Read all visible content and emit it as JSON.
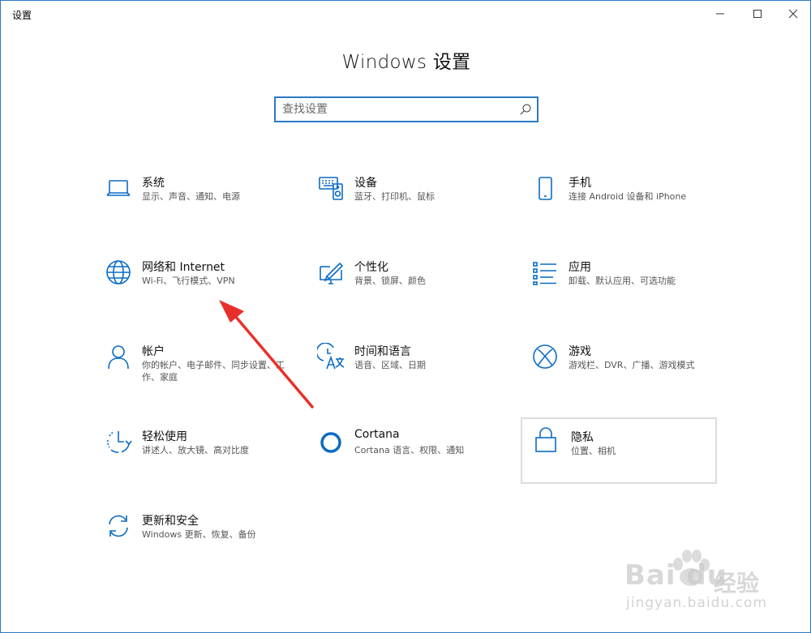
{
  "window": {
    "title": "设置"
  },
  "header": {
    "title": "Windows 设置"
  },
  "search": {
    "placeholder": "查找设置",
    "value": ""
  },
  "tiles": [
    {
      "id": "system",
      "icon": "laptop-icon",
      "title": "系统",
      "desc": "显示、声音、通知、电源"
    },
    {
      "id": "devices",
      "icon": "devices-icon",
      "title": "设备",
      "desc": "蓝牙、打印机、鼠标"
    },
    {
      "id": "phone",
      "icon": "phone-icon",
      "title": "手机",
      "desc": "连接 Android 设备和 iPhone"
    },
    {
      "id": "network",
      "icon": "globe-icon",
      "title": "网络和 Internet",
      "desc": "Wi-Fi、飞行模式、VPN"
    },
    {
      "id": "personalization",
      "icon": "personalization-icon",
      "title": "个性化",
      "desc": "背景、锁屏、颜色"
    },
    {
      "id": "apps",
      "icon": "apps-list-icon",
      "title": "应用",
      "desc": "卸载、默认应用、可选功能"
    },
    {
      "id": "accounts",
      "icon": "person-icon",
      "title": "帐户",
      "desc": "你的帐户、电子邮件、同步设置、工作、家庭"
    },
    {
      "id": "time-language",
      "icon": "time-language-icon",
      "title": "时间和语言",
      "desc": "语音、区域、日期"
    },
    {
      "id": "gaming",
      "icon": "xbox-icon",
      "title": "游戏",
      "desc": "游戏栏、DVR、广播、游戏模式"
    },
    {
      "id": "ease-of-access",
      "icon": "ease-of-access-icon",
      "title": "轻松使用",
      "desc": "讲述人、放大镜、高对比度"
    },
    {
      "id": "cortana",
      "icon": "cortana-icon",
      "title": "Cortana",
      "desc": "Cortana 语言、权限、通知"
    },
    {
      "id": "privacy",
      "icon": "lock-icon",
      "title": "隐私",
      "desc": "位置、相机"
    },
    {
      "id": "update-security",
      "icon": "sync-icon",
      "title": "更新和安全",
      "desc": "Windows 更新、恢复、备份"
    }
  ],
  "watermark": {
    "brand": "Bai du",
    "brand_cn": "经验",
    "url": "jingyan.baidu.com"
  },
  "colors": {
    "accent": "#0b6cc4",
    "border": "#2b79c2",
    "arrow": "#e8302a"
  }
}
